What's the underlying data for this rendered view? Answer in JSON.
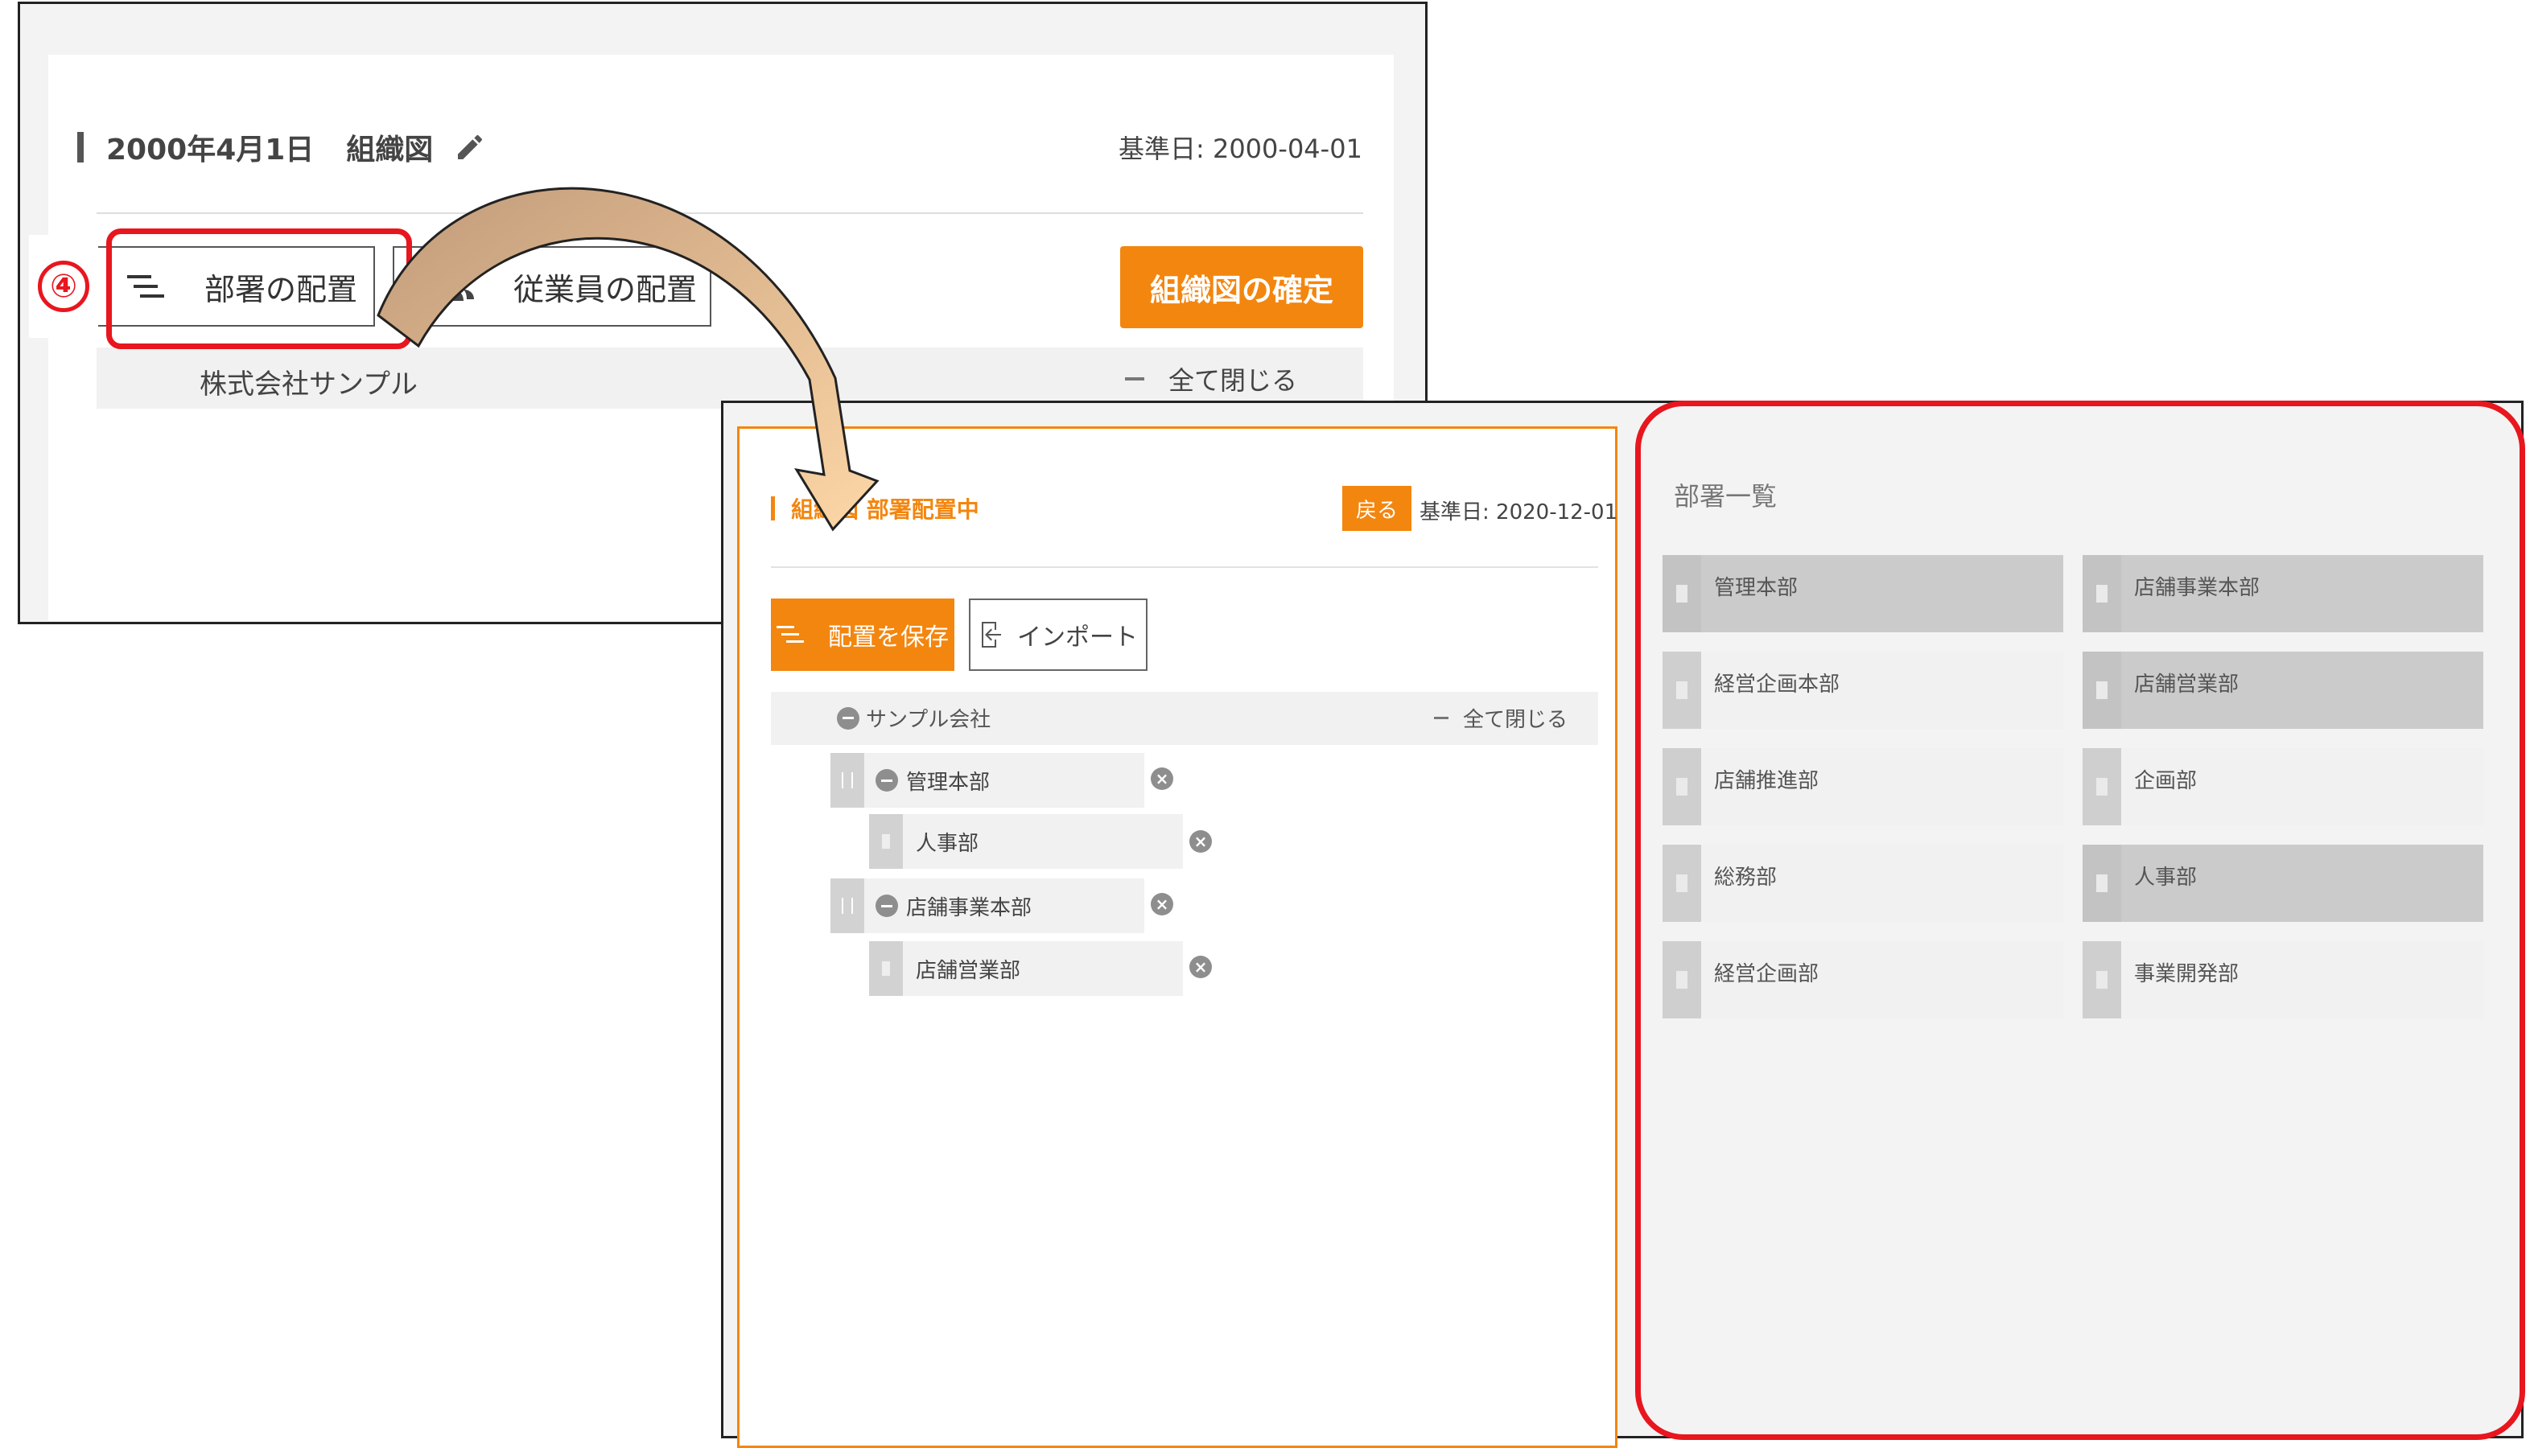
{
  "top_window": {
    "title_date": "2000年4月1日",
    "title_suffix": "組織図",
    "base_date": "基準日: 2000-04-01",
    "step_number": "④",
    "dept_button": "部署の配置",
    "employee_button": "従業員の配置",
    "confirm_button": "組織図の確定",
    "root_name": "株式会社サンプル",
    "collapse_all": "全て閉じる"
  },
  "bottom_window": {
    "title": "組織図 部署配置中",
    "back_button": "戻る",
    "base_date": "基準日: 2020-12-01",
    "save_button": "配置を保存",
    "import_button": "インポート",
    "root_name": "サンプル会社",
    "collapse_all": "全て閉じる",
    "tree": [
      {
        "label": "管理本部",
        "level": 1,
        "collapsible": true
      },
      {
        "label": "人事部",
        "level": 2,
        "collapsible": false
      },
      {
        "label": "店舗事業本部",
        "level": 1,
        "collapsible": true
      },
      {
        "label": "店舗営業部",
        "level": 2,
        "collapsible": false
      }
    ],
    "dept_list_title": "部署一覧",
    "dept_list": [
      {
        "label": "管理本部",
        "placed": true
      },
      {
        "label": "店舗事業本部",
        "placed": true
      },
      {
        "label": "経営企画本部",
        "placed": false
      },
      {
        "label": "店舗営業部",
        "placed": true
      },
      {
        "label": "店舗推進部",
        "placed": false
      },
      {
        "label": "企画部",
        "placed": false
      },
      {
        "label": "総務部",
        "placed": false
      },
      {
        "label": "人事部",
        "placed": true
      },
      {
        "label": "経営企画部",
        "placed": false
      },
      {
        "label": "事業開発部",
        "placed": false
      }
    ]
  },
  "colors": {
    "accent": "#f3860f",
    "highlight": "#e8161e",
    "arrow_start": "#c19a7a",
    "arrow_end": "#fdd7a6"
  }
}
